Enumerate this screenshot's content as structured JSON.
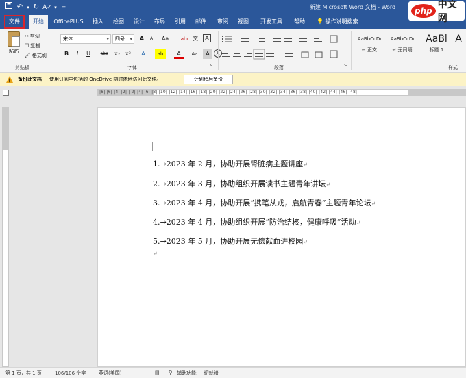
{
  "title_bar": {
    "title": "新建 Microsoft Word 文档 - Word",
    "qat": {
      "save": "save-icon",
      "undo": "undo-icon",
      "redo": "redo-icon",
      "spell": "spelling-icon",
      "more": "more-icon"
    }
  },
  "watermark": {
    "logo": "php",
    "text": "中文网"
  },
  "tabs": [
    "文件",
    "开始",
    "OfficePLUS",
    "插入",
    "绘图",
    "设计",
    "布局",
    "引用",
    "邮件",
    "审阅",
    "视图",
    "开发工具",
    "帮助"
  ],
  "tell_me": "操作说明搜索",
  "ribbon": {
    "clipboard": {
      "paste": "粘贴",
      "cut": "剪切",
      "copy": "复制",
      "format_painter": "格式刷",
      "label": "剪贴板"
    },
    "font": {
      "font_name": "宋体",
      "font_size": "四号",
      "label": "字体",
      "buttons": [
        "A",
        "A",
        "Aa",
        "abc",
        "文",
        "A",
        "B",
        "I",
        "U",
        "abc",
        "x₂",
        "x²",
        "A",
        "ab",
        "A",
        "Aa",
        "A",
        "A"
      ]
    },
    "paragraph": {
      "label": "段落"
    },
    "styles": {
      "label": "样式",
      "items": [
        {
          "sample": "AaBbCcDı",
          "name": "↵ 正文"
        },
        {
          "sample": "AaBbCcDı",
          "name": "↵ 无间隔"
        },
        {
          "sample": "AaBl",
          "name": "标题 1"
        },
        {
          "sample": "A",
          "name": ""
        }
      ]
    }
  },
  "info_bar": {
    "bold": "备份此文档",
    "message": "使用订阅中包括的 OneDrive 随时随地访问此文件。",
    "button": "计划稍后备份"
  },
  "ruler": {
    "numbers": "|8| |6| |4| |2| | 2| |4| |6| |8| |10| |12| |14| |16| |18| |20| |22| |24| |26| |28| |30| |32| |34| |36| |38| |40| |42| |44| |46| |48|"
  },
  "document": {
    "lines": [
      "1.→2023 年 2 月，协助开展肾脏病主题讲座",
      "2.→2023 年 3 月，协助组织开展读书主题青年讲坛",
      "3.→2023 年 4 月，协助开展“携笔从戎，启航青春”主题青年论坛",
      "4.→2023 年 4 月，协助组织开展“防治结核，健康呼吸”活动",
      "5.→2023 年 5 月，协助开展无偿献血进校园"
    ],
    "paragraph_mark": "↵"
  },
  "status_bar": {
    "page": "第 1 页，共 1 页",
    "words": "106/106 个字",
    "language": "英语(美国)",
    "accessibility": "辅助功能: 一切就绪"
  }
}
